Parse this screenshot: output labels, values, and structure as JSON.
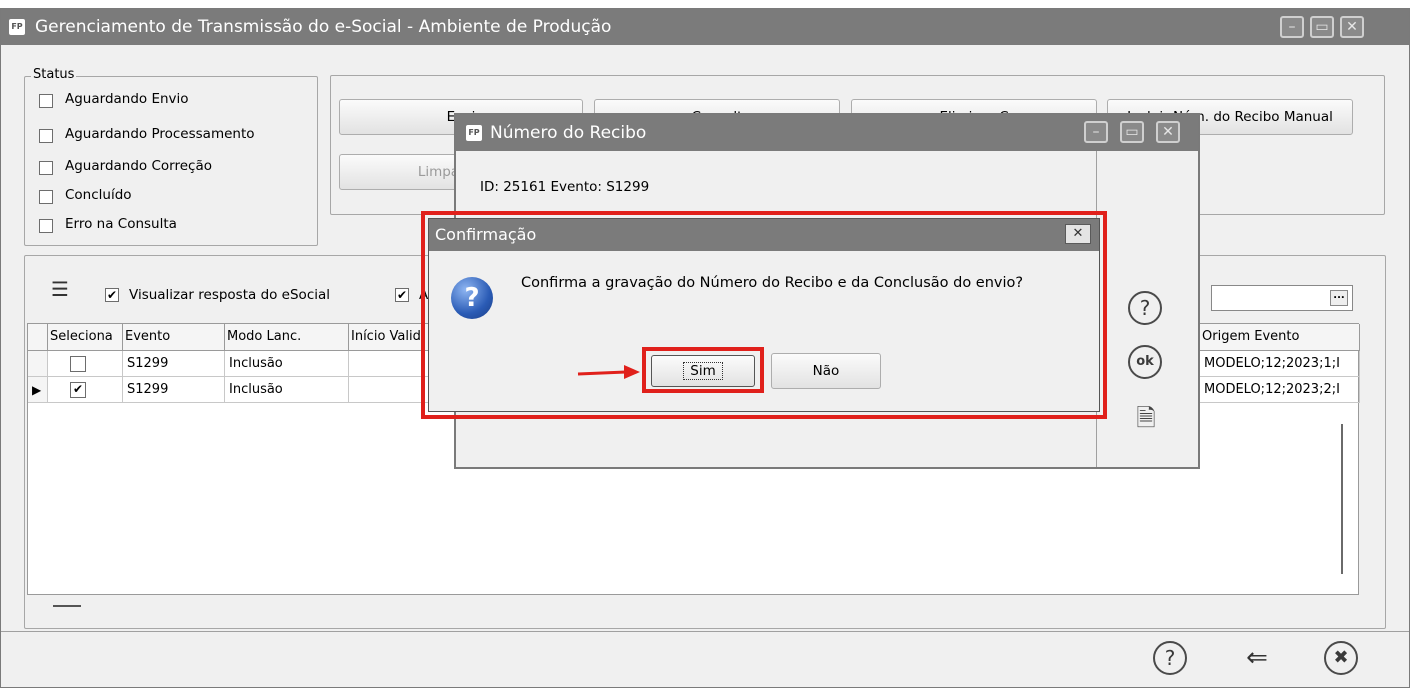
{
  "main_window": {
    "app_icon": "FP",
    "title": "Gerenciamento de Transmissão do e-Social - Ambiente de Produção"
  },
  "status": {
    "legend": "Status",
    "options": [
      {
        "label": "Aguardando Envio",
        "checked": false
      },
      {
        "label": "Aguardando Processamento",
        "checked": false
      },
      {
        "label": "Aguardando Correção",
        "checked": false
      },
      {
        "label": "Concluído",
        "checked": false
      },
      {
        "label": "Erro na Consulta",
        "checked": false
      }
    ]
  },
  "actions": {
    "btn1": "Envi",
    "btn2": "Consult",
    "btn3": "Eliminar C",
    "btn4": "Incluir Núm. do Recibo Manual",
    "btn4_visible": ". do Recibo Manual",
    "btn5": "Limpar (Prod"
  },
  "options_bar": {
    "view_response_label": "Visualizar resposta do eSocial",
    "view_response_checked": true,
    "second_checkbox_label": "A",
    "second_checkbox_checked": true,
    "dropdown_button": "..."
  },
  "grid": {
    "columns": [
      "Seleciona",
      "Evento",
      "Modo Lanc.",
      "Início Valid",
      "Origem Evento"
    ],
    "rows": [
      {
        "selected": false,
        "evento": "S1299",
        "modo": "Inclusão",
        "inicio": "",
        "origem": "MODELO;12;2023;1;I",
        "current": false
      },
      {
        "selected": true,
        "evento": "S1299",
        "modo": "Inclusão",
        "inicio": "",
        "origem": "MODELO;12;2023;2;I",
        "current": true
      }
    ]
  },
  "recibo_dialog": {
    "app_icon": "FP",
    "title": "Número do Recibo",
    "info": "ID: 25161 Evento: S1299"
  },
  "confirm_dialog": {
    "title": "Confirmação",
    "message": "Confirma a gravação do Número do Recibo e da Conclusão do envio?",
    "yes": "Sim",
    "no": "Não",
    "close": "✕"
  },
  "colors": {
    "titlebar": "#7b7b7b",
    "highlight": "#e0201b",
    "question_icon": "#2a5bb5"
  }
}
